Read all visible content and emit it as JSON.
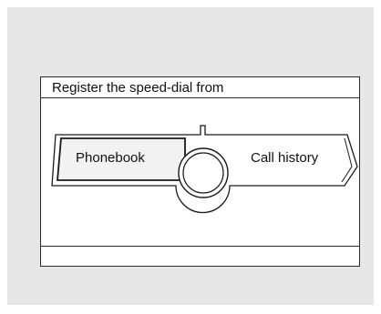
{
  "dialog": {
    "title": "Register the speed-dial from",
    "options": [
      {
        "label": "Phonebook",
        "selected": true
      },
      {
        "label": "Call history",
        "selected": false
      }
    ]
  }
}
